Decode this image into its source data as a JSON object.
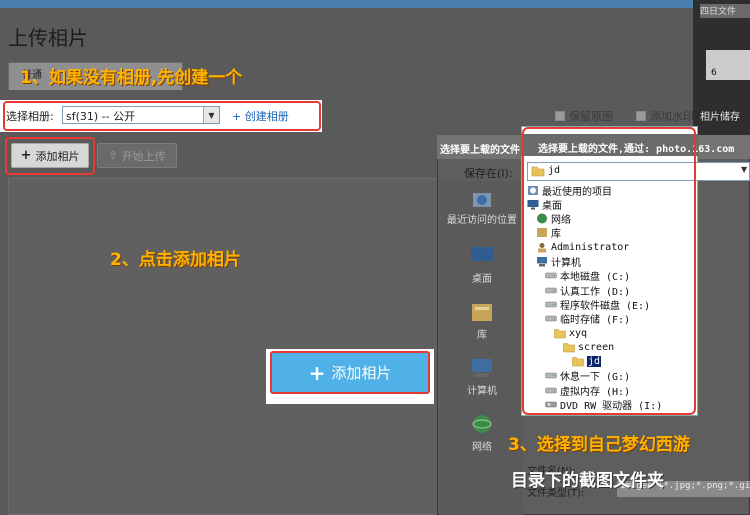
{
  "page": {
    "title": "上传相片",
    "tab_normal": "普通",
    "album_label": "选择相册:",
    "album_value": "sf(31) -- 公开",
    "create_album": "+ 创建相册",
    "keep_original": "保留原图",
    "add_watermark": "添加水印",
    "add_photo": "添加相片",
    "start_upload": "开始上传",
    "big_add_photo": "添加相片"
  },
  "right_strip": {
    "top_label": "四日文件",
    "side_label": "相片储存",
    "ruler_number": "6"
  },
  "dialog": {
    "title": "选择要上载的文件,通过:",
    "save_in_label": "保存在(I):",
    "places": [
      "最近访问的位置",
      "桌面",
      "库",
      "计算机",
      "网络"
    ],
    "filename_label": "文件名(N):",
    "filetype_label": "文件类型(T):",
    "filetype_value": "Images (*.jpg;*.png;*.gif)"
  },
  "tree": {
    "title": "选择要上载的文件,通过: photo.163.com",
    "combo_value": "jd",
    "nodes": [
      {
        "label": "最近使用的项目",
        "indent": 0,
        "icon": "recent-icon"
      },
      {
        "label": "桌面",
        "indent": 0,
        "icon": "desktop-icon"
      },
      {
        "label": "网络",
        "indent": 1,
        "icon": "network-icon"
      },
      {
        "label": "库",
        "indent": 1,
        "icon": "library-icon"
      },
      {
        "label": "Administrator",
        "indent": 1,
        "icon": "user-icon"
      },
      {
        "label": "计算机",
        "indent": 1,
        "icon": "computer-icon"
      },
      {
        "label": "本地磁盘 (C:)",
        "indent": 2,
        "icon": "drive-icon"
      },
      {
        "label": "认真工作 (D:)",
        "indent": 2,
        "icon": "drive-icon"
      },
      {
        "label": "程序软件磁盘 (E:)",
        "indent": 2,
        "icon": "drive-icon"
      },
      {
        "label": "临时存储 (F:)",
        "indent": 2,
        "icon": "drive-icon"
      },
      {
        "label": "xyq",
        "indent": 3,
        "icon": "folder-icon"
      },
      {
        "label": "screen",
        "indent": 4,
        "icon": "folder-icon"
      },
      {
        "label": "jd",
        "indent": 5,
        "icon": "folder-icon",
        "selected": true
      },
      {
        "label": "休息一下 (G:)",
        "indent": 2,
        "icon": "drive-icon"
      },
      {
        "label": "虚拟内存 (H:)",
        "indent": 2,
        "icon": "drive-icon"
      },
      {
        "label": "DVD RW 驱动器 (I:)",
        "indent": 2,
        "icon": "dvd-icon"
      }
    ]
  },
  "annotations": {
    "step1": "1、如果没有相册,先创建一个",
    "step2": "2、点击添加相片",
    "step3_line1": "3、选择到自己梦幻西游",
    "step3_line2": "目录下的截图文件夹"
  },
  "colors": {
    "highlight_border": "#e53935",
    "annotation_text": "#ffb300",
    "big_button_bg": "#4fb1e6",
    "link_blue": "#1b63b8"
  }
}
